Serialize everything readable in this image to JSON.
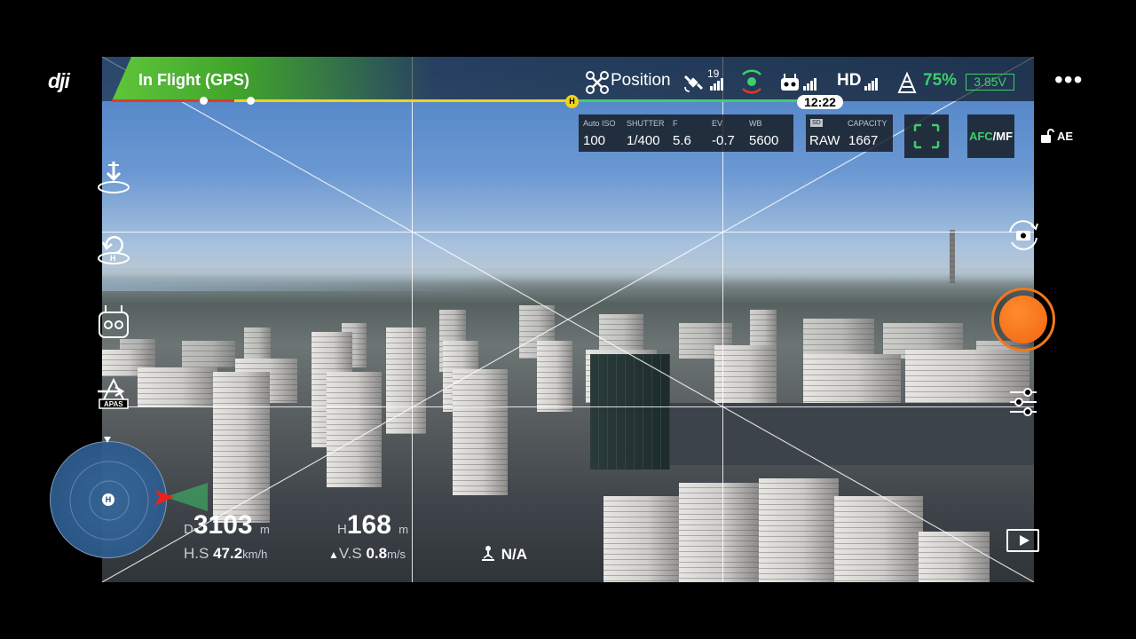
{
  "app": {
    "logo": "dji"
  },
  "status": {
    "flight_mode": "In Flight (GPS)",
    "flight_time": "12:22",
    "home_marker": "H"
  },
  "topbar": {
    "mode": "Position",
    "gps_satellites": "19",
    "remote_label": "",
    "hd_label": "HD",
    "battery_percent": "75%",
    "battery_voltage": "3.85V"
  },
  "camera_params": {
    "iso_label": "Auto ISO",
    "iso_value": "100",
    "shutter_label": "SHUTTER",
    "shutter_value": "1/400",
    "f_label": "F",
    "f_value": "5.6",
    "ev_label": "EV",
    "ev_value": "-0.7",
    "wb_label": "WB",
    "wb_value": "5600",
    "storage_badge": "SD",
    "format_value": "RAW",
    "capacity_label": "CAPACITY",
    "capacity_value": "1667"
  },
  "focus": {
    "afc": "AFC",
    "sep": "/",
    "mf": "MF"
  },
  "exposure_lock": {
    "label": "AE"
  },
  "left_tools": {
    "apas_label": "APAS"
  },
  "radar": {
    "home_marker": "H"
  },
  "telemetry": {
    "distance_label": "D",
    "distance_value": "3103",
    "distance_unit": "m",
    "height_label": "H",
    "height_value": "168",
    "height_unit": "m",
    "hspeed_label": "H.S",
    "hspeed_value": "47.2",
    "hspeed_unit": "km/h",
    "vspeed_label": "V.S",
    "vspeed_value": "0.8",
    "vspeed_unit": "m/s",
    "vision_value": "N/A"
  },
  "colors": {
    "accent_green": "#3ccf6a",
    "flight_green": "#5fc63a",
    "progress_yellow": "#f2d21b",
    "shutter_orange": "#f06512"
  }
}
